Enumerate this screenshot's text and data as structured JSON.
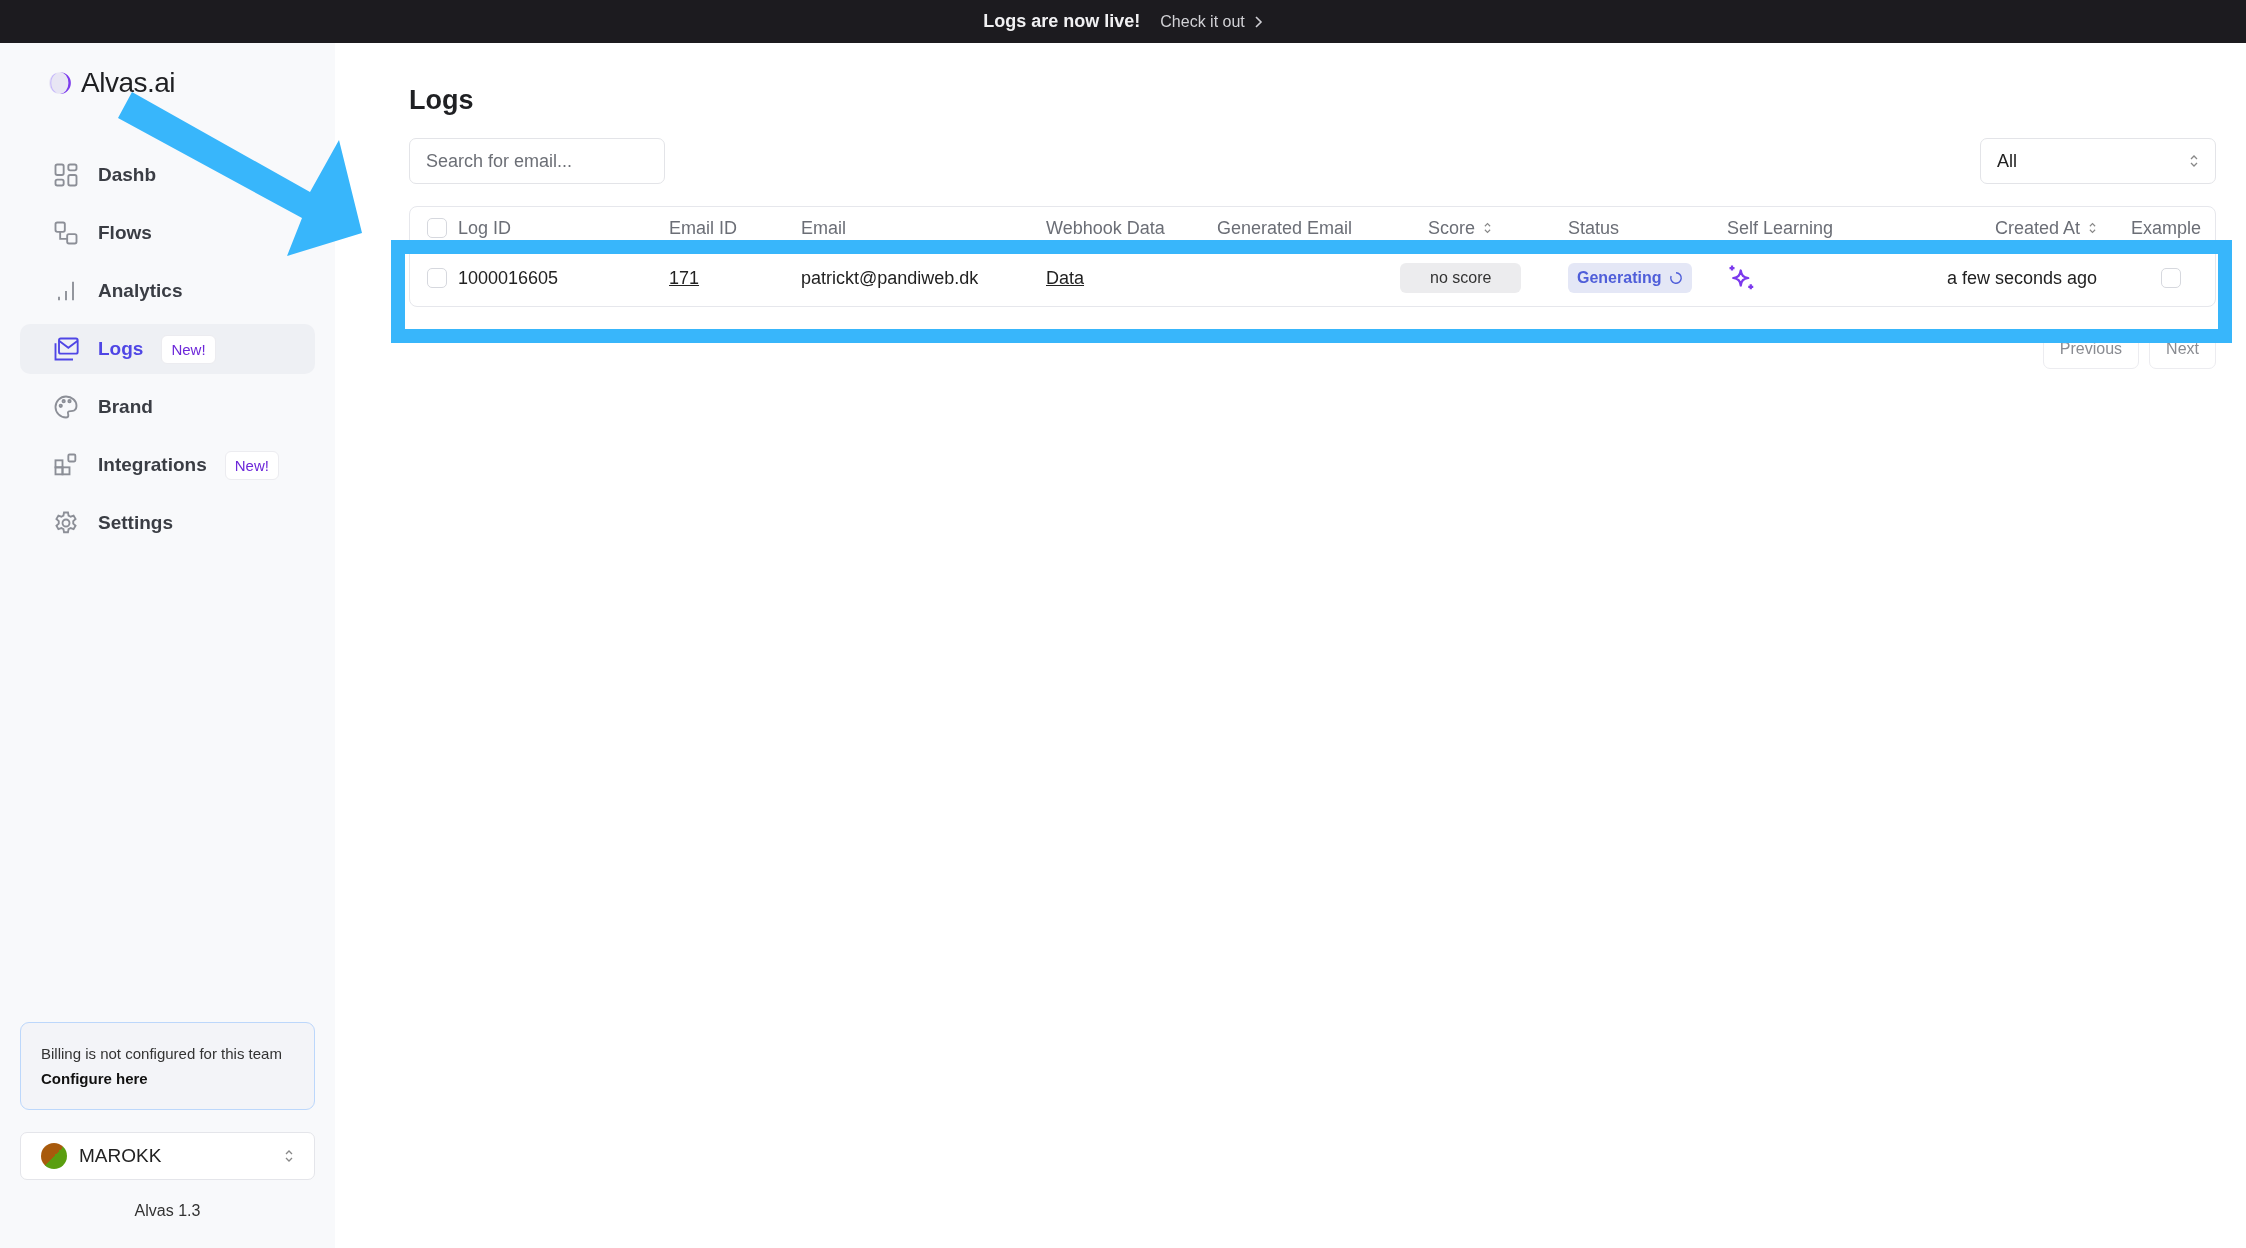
{
  "banner": {
    "message": "Logs are now live!",
    "link": "Check it out"
  },
  "sidebar": {
    "logo": "Alvas.ai",
    "nav_items": [
      {
        "label": "Dashb",
        "selected": false
      },
      {
        "label": "Flows",
        "selected": false
      },
      {
        "label": "Analytics",
        "selected": false
      },
      {
        "label": "Logs",
        "selected": true,
        "badge": "New!"
      },
      {
        "label": "Brand",
        "selected": false
      },
      {
        "label": "Integrations",
        "selected": false,
        "badge": "New!"
      },
      {
        "label": "Settings",
        "selected": false
      }
    ],
    "billing": {
      "message": "Billing is not configured for this team",
      "link": "Configure here"
    },
    "team": {
      "name": "MAROKK"
    },
    "version": "Alvas 1.3"
  },
  "main": {
    "title": "Logs",
    "search": {
      "placeholder": "Search for email..."
    },
    "filter": {
      "value": "All"
    },
    "table": {
      "select_all": {
        "checked": false
      },
      "columns": [
        {
          "label": "Log ID",
          "sortable": false
        },
        {
          "label": "Email ID",
          "sortable": false
        },
        {
          "label": "Email",
          "sortable": false
        },
        {
          "label": "Webhook Data",
          "sortable": false
        },
        {
          "label": "Generated Email",
          "sortable": false
        },
        {
          "label": "Score",
          "sortable": true
        },
        {
          "label": "Status",
          "sortable": false
        },
        {
          "label": "Self Learning",
          "sortable": false
        },
        {
          "label": "Created At",
          "sortable": true
        },
        {
          "label": "Example",
          "sortable": false
        }
      ],
      "rows": [
        {
          "selected": false,
          "log_id": "1000016605",
          "email_id": "171",
          "email": "patrickt@pandiweb.dk",
          "webhook_data": "Data",
          "score": "no score",
          "status": {
            "label": "Generating",
            "kind": "generating"
          },
          "created_at": "a few seconds ago",
          "example": false
        }
      ]
    },
    "pagination": [
      {
        "label": "Previous",
        "disabled": true
      },
      {
        "label": "Next",
        "disabled": true
      }
    ]
  }
}
